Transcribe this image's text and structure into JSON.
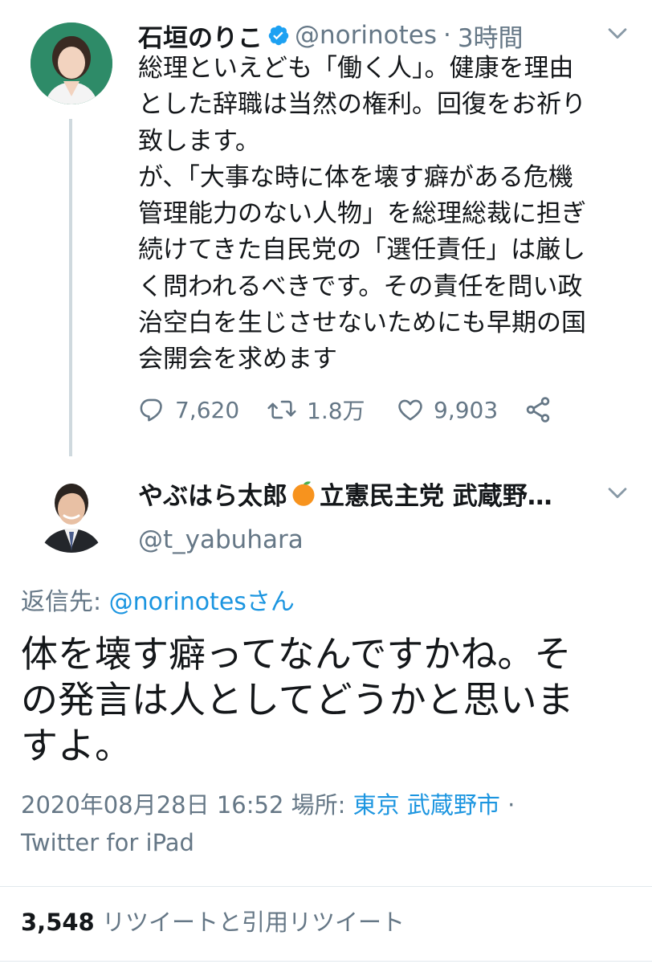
{
  "parent_tweet": {
    "display_name": "石垣のりこ",
    "handle": "@norinotes",
    "separator": "·",
    "time": "3時間",
    "text_lines": [
      "総理といえども「働く人」。健康を理由",
      "とした辞職は当然の権利。回復をお祈り",
      "致します。",
      "が、「大事な時に体を壊す癖がある危機",
      "管理能力のない人物」を総理総裁に担ぎ",
      "続けてきた自民党の「選任責任」は厳し",
      "く問われるべきです。その責任を問い政",
      "治空白を生じさせないためにも早期の国",
      "会開会を求めます"
    ],
    "reply_count": "7,620",
    "retweet_count": "1.8万",
    "like_count": "9,903"
  },
  "main_tweet": {
    "display_name_before": "やぶはら太郎",
    "display_name_after": "立憲民主党 武蔵野…",
    "handle": "@t_yabuhara",
    "reply_to_label": "返信先: ",
    "reply_to_handle": "@norinotesさん",
    "text_lines": [
      "体を壊す癖ってなんですかね。そ",
      "の発言は人としてどうかと思いま",
      "すよ。"
    ],
    "timestamp": "2020年08月28日 16:52",
    "location_label": "場所: ",
    "location": "東京 武蔵野市",
    "separator": "·",
    "source": "Twitter for iPad",
    "retweet_total": "3,548",
    "retweet_total_label": "リツイートと引用リツイート"
  },
  "colors": {
    "accent": "#1b95e0",
    "muted": "#657786",
    "text": "#14171a",
    "verified": "#1da1f2",
    "orange": "#f7931e",
    "thread_line": "#cfd9de"
  },
  "icons": [
    "verified-badge-icon",
    "chevron-down-icon",
    "reply-icon",
    "retweet-icon",
    "like-icon",
    "share-icon",
    "orange-emoji-icon"
  ]
}
